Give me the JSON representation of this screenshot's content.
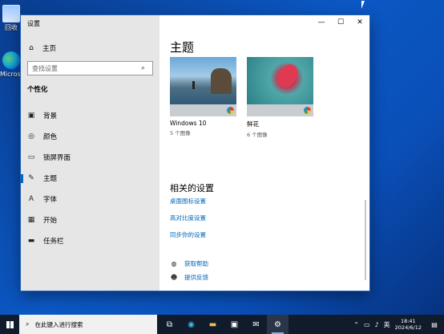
{
  "desktop": {
    "icons": [
      {
        "label": "回收",
        "icon": "recycle-bin-icon"
      },
      {
        "label": "Microsoft Edge",
        "icon": "edge-icon"
      }
    ]
  },
  "window": {
    "title": "设置",
    "controls": {
      "minimize": "—",
      "maximize": "☐",
      "close": "✕"
    }
  },
  "sidebar": {
    "home_label": "主页",
    "search_placeholder": "查找设置",
    "section": "个性化",
    "items": [
      {
        "label": "背景",
        "icon": "picture-icon"
      },
      {
        "label": "颜色",
        "icon": "palette-icon"
      },
      {
        "label": "锁屏界面",
        "icon": "lock-screen-icon"
      },
      {
        "label": "主题",
        "icon": "brush-icon",
        "active": true
      },
      {
        "label": "字体",
        "icon": "font-icon"
      },
      {
        "label": "开始",
        "icon": "start-icon"
      },
      {
        "label": "任务栏",
        "icon": "taskbar-icon"
      }
    ]
  },
  "main": {
    "heading": "主题",
    "themes": [
      {
        "name": "Windows 10",
        "count": "5 个图像"
      },
      {
        "name": "鲜花",
        "count": "6 个图像"
      }
    ],
    "related_heading": "相关的设置",
    "related_links": [
      "桌面图标设置",
      "高对比度设置",
      "同步你的设置"
    ],
    "help": [
      {
        "label": "获取帮助",
        "icon": "help-chat-icon"
      },
      {
        "label": "提供反馈",
        "icon": "feedback-icon"
      }
    ]
  },
  "taskbar": {
    "search_placeholder": "在此键入进行搜索",
    "apps": [
      "task-view-icon",
      "edge-icon",
      "file-explorer-icon",
      "store-icon",
      "mail-icon",
      "settings-icon"
    ],
    "tray": {
      "ime": "英",
      "time": "18:41",
      "date": "2024/6/12"
    }
  },
  "colors": {
    "accent": "#0067c0",
    "link": "#0066b8",
    "sidebar_bg": "#e6e6e6",
    "taskbar_bg": "#101b2b"
  }
}
